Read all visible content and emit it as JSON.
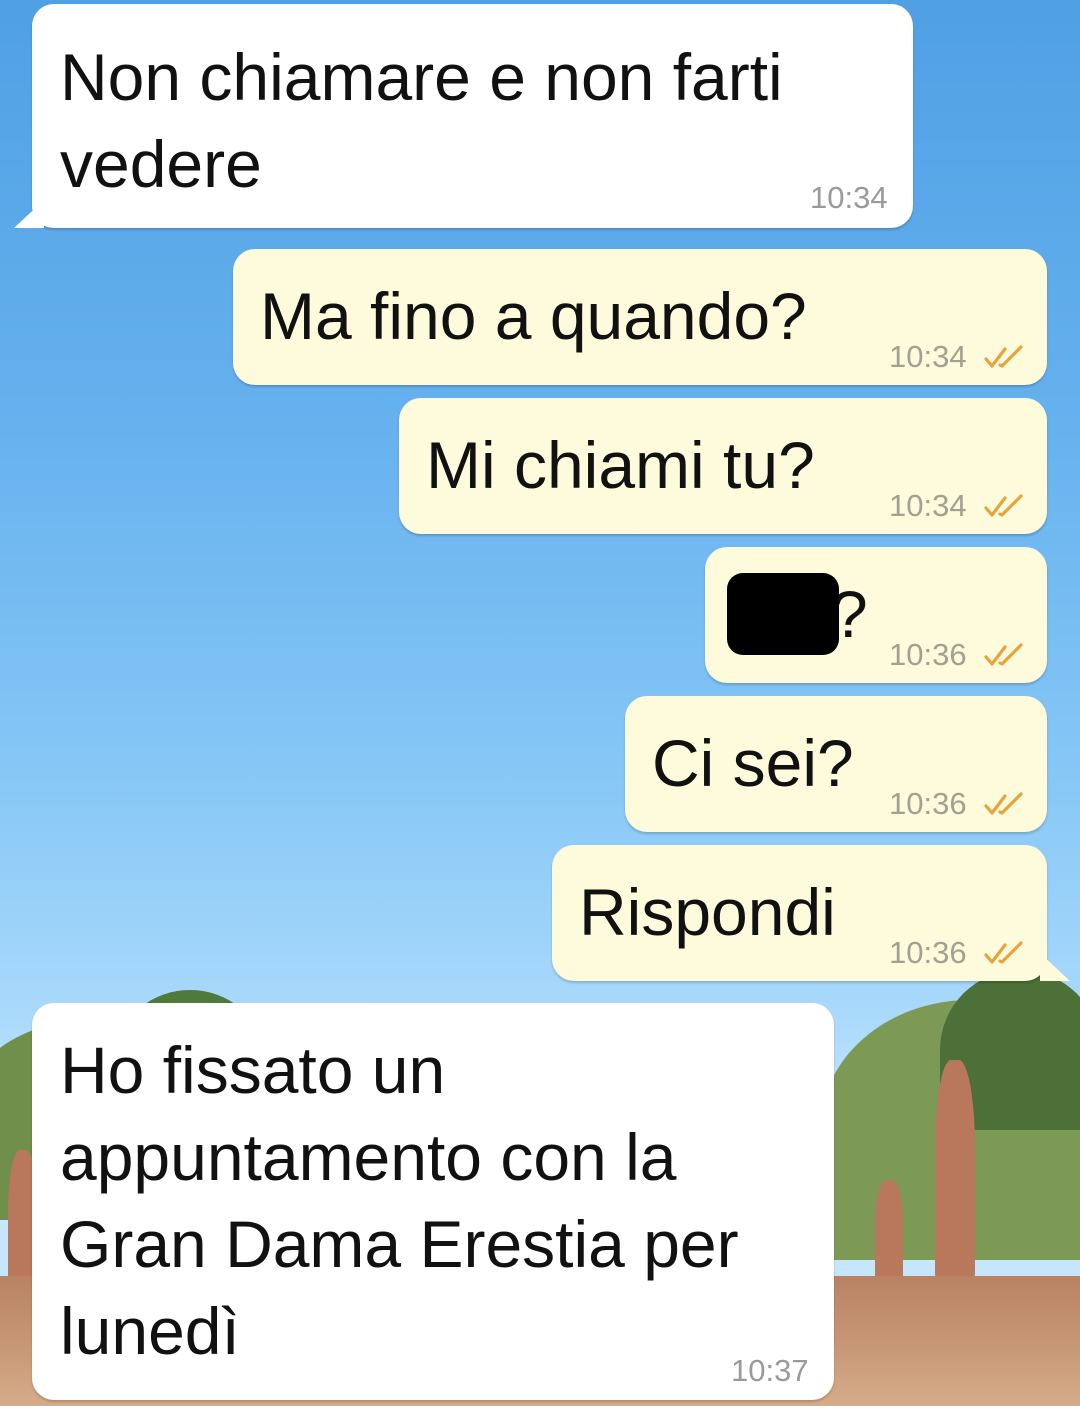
{
  "messages": [
    {
      "direction": "in",
      "lines": [
        "Non chiamare e non farti",
        "vedere"
      ],
      "time": "10:34"
    },
    {
      "direction": "out",
      "text": "Ma fino a quando?",
      "time": "10:34",
      "status": "read"
    },
    {
      "direction": "out",
      "text": "Mi chiami tu?",
      "time": "10:34",
      "status": "read"
    },
    {
      "direction": "out",
      "text": "?",
      "time": "10:36",
      "status": "read",
      "redacted": true
    },
    {
      "direction": "out",
      "text": "Ci sei?",
      "time": "10:36",
      "status": "read"
    },
    {
      "direction": "out",
      "text": "Rispondi",
      "time": "10:36",
      "status": "read"
    },
    {
      "direction": "in",
      "lines": [
        "Ho fissato un",
        "appuntamento con la",
        "Gran Dama Erestia per",
        "lunedì"
      ],
      "time": "10:37"
    }
  ],
  "colors": {
    "incoming_bubble": "#ffffff",
    "outgoing_bubble": "#fefbdd",
    "read_ticks": "#e8a33c",
    "timestamp": "#9a9a9a"
  },
  "icons": {
    "read_status": "double-check-icon"
  }
}
